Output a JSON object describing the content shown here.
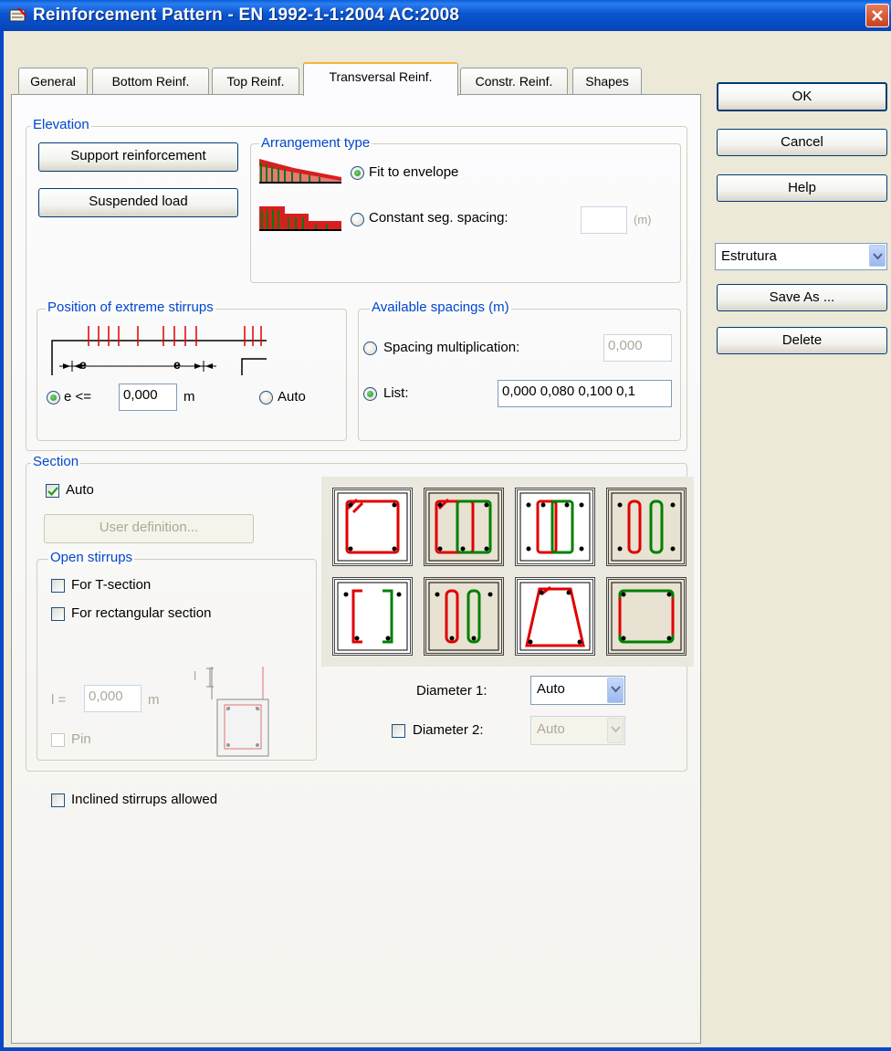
{
  "window": {
    "title": "Reinforcement Pattern - EN 1992-1-1:2004 AC:2008"
  },
  "tabs": [
    {
      "label": "General"
    },
    {
      "label": "Bottom Reinf."
    },
    {
      "label": "Top Reinf."
    },
    {
      "label": "Transversal Reinf."
    },
    {
      "label": "Constr. Reinf."
    },
    {
      "label": "Shapes"
    }
  ],
  "side": {
    "ok": "OK",
    "cancel": "Cancel",
    "help": "Help",
    "preset": "Estrutura",
    "save_as": "Save As ...",
    "delete": "Delete"
  },
  "elevation": {
    "legend": "Elevation",
    "support_btn": "Support reinforcement",
    "suspended_btn": "Suspended load",
    "arrangement": {
      "legend": "Arrangement type",
      "fit": "Fit to envelope",
      "constant": "Constant seg. spacing:",
      "unit": "(m)",
      "constant_value": ""
    }
  },
  "extreme": {
    "legend": "Position of extreme stirrups",
    "e_label": "e <=",
    "e_value": "0,000",
    "e_unit": "m",
    "auto": "Auto",
    "diagram_e": "e"
  },
  "spacings": {
    "legend": "Available spacings (m)",
    "mult_label": "Spacing multiplication:",
    "mult_value": "0,000",
    "list_label": "List:",
    "list_value": "0,000 0,080 0,100 0,1"
  },
  "section": {
    "legend": "Section",
    "auto": "Auto",
    "user_def": "User definition...",
    "open": {
      "legend": "Open stirrups",
      "t_section": "For T-section",
      "rect_section": "For rectangular section",
      "l_label": "l =",
      "l_value": "0,000",
      "l_unit": "m",
      "pin": "Pin",
      "diagram_l": "l"
    },
    "diameter1_label": "Diameter 1:",
    "diameter1_value": "Auto",
    "diameter2_label": "Diameter 2:",
    "diameter2_value": "Auto"
  },
  "inclined": "Inclined stirrups allowed",
  "colors": {
    "accent": "#0046d5",
    "titlebar": "#0a55d0",
    "red": "#e00000",
    "green": "#008000"
  }
}
